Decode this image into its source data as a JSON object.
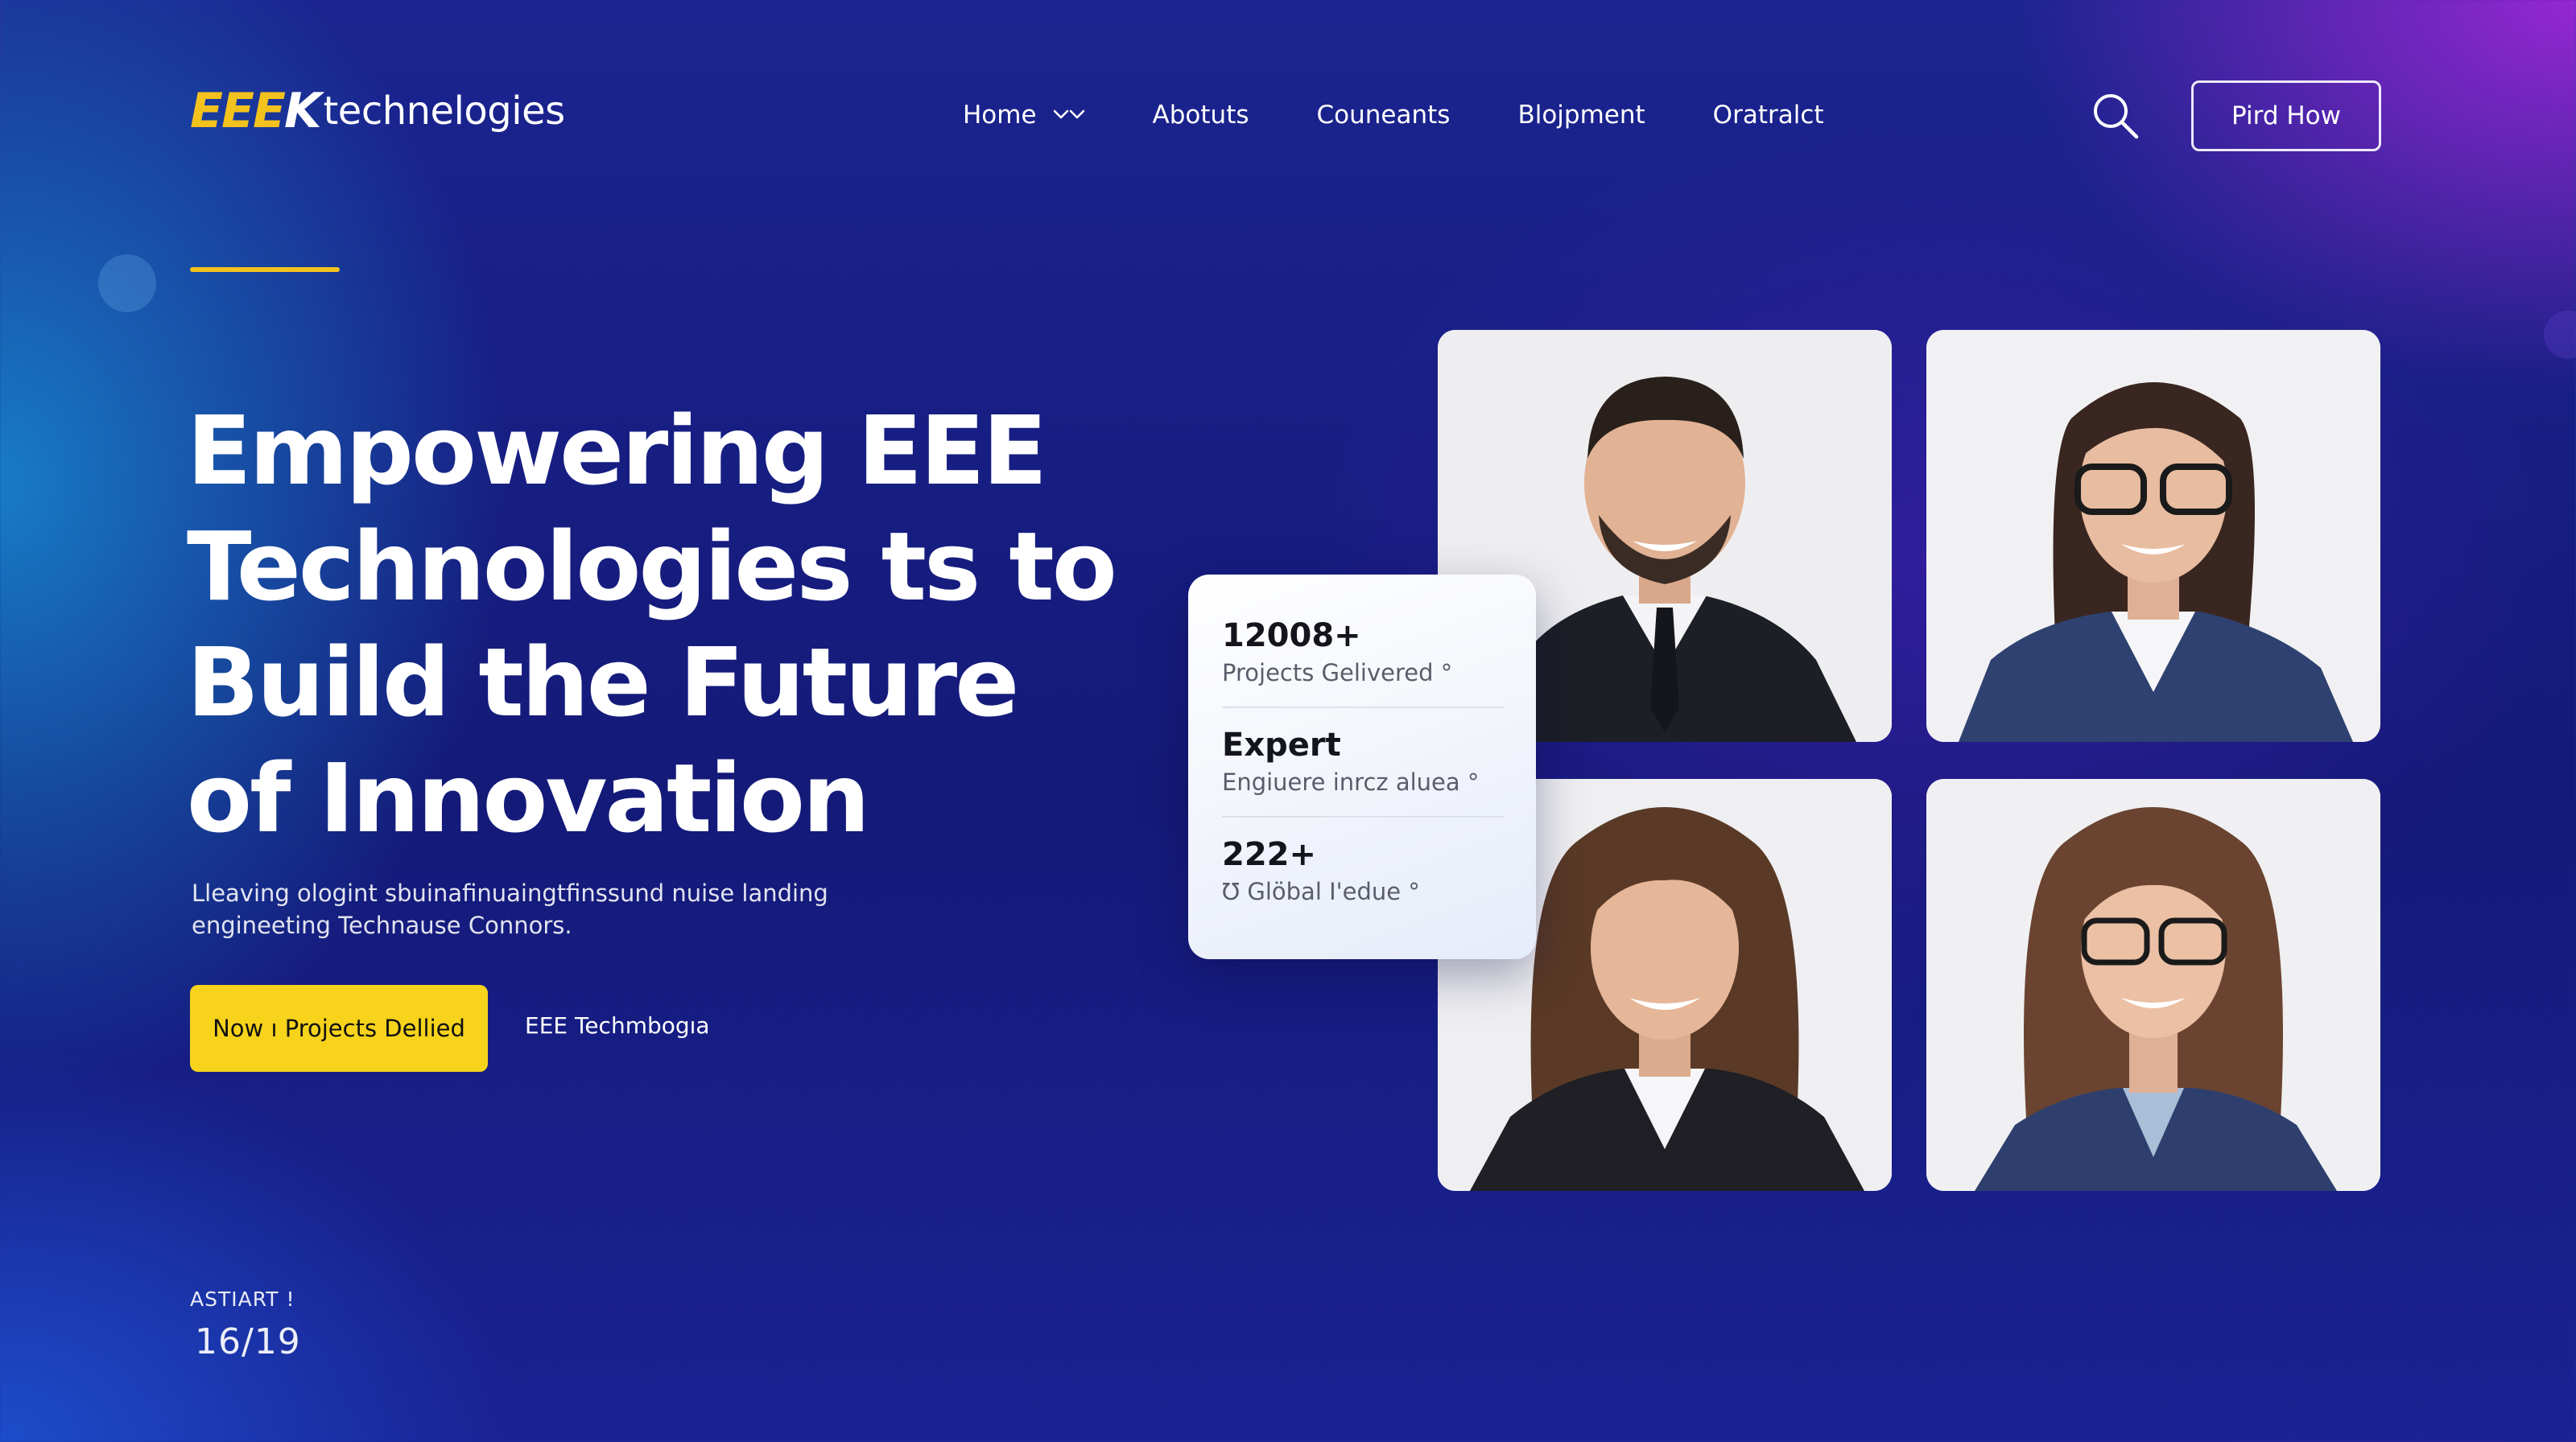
{
  "brand": {
    "mark": "EEE",
    "mark_k": "K",
    "name": "technelogies",
    "accent_color": "#f4c21d"
  },
  "nav": {
    "items": [
      {
        "label": "Home",
        "has_dropdown": true
      },
      {
        "label": "Abotuts"
      },
      {
        "label": "Couneants"
      },
      {
        "label": "Blojpment"
      },
      {
        "label": "Oratralct"
      }
    ],
    "search_icon": "search-icon",
    "cta_label": "Pird How"
  },
  "hero": {
    "title_lines": [
      "Empowering EEE",
      "Technologies ts to",
      "Build the Future",
      "of Innovation"
    ],
    "subtitle_lines": [
      "Lleaving ologint sbuinafinuaingtfinssund nuise landing",
      "engineeting Technause Connors."
    ],
    "primary_button": "Now ı Projects Dellied",
    "secondary_link": "EEE Techmbogıa",
    "counter_label": "ASTIART !",
    "counter_value": "16/19"
  },
  "stats": [
    {
      "value": "12008+",
      "label": "Projects Gelivered °"
    },
    {
      "value": "Expert",
      "label": "Engiuere inrcz aluea °"
    },
    {
      "value": "222+",
      "label": "℧ Glöbal I'edue °"
    }
  ],
  "team_photos": [
    {
      "icon": "man-suit-portrait"
    },
    {
      "icon": "woman-glasses-portrait"
    },
    {
      "icon": "woman-blazer-portrait"
    },
    {
      "icon": "woman-glasses-longhair-portrait"
    }
  ]
}
